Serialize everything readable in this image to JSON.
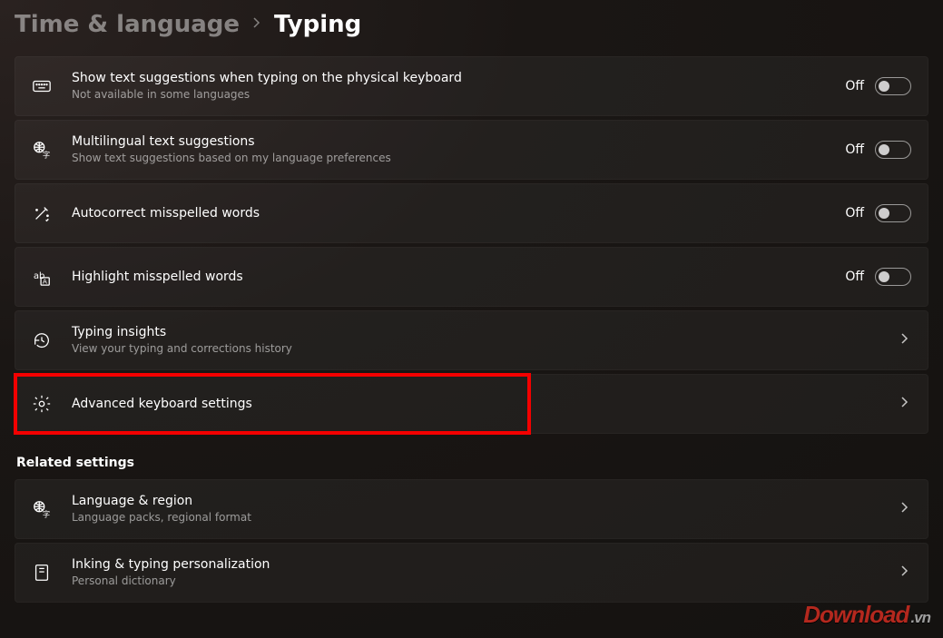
{
  "breadcrumb": {
    "parent": "Time & language",
    "current": "Typing"
  },
  "toggles": {
    "off_label": "Off"
  },
  "items": [
    {
      "icon": "keyboard-icon",
      "title": "Show text suggestions when typing on the physical keyboard",
      "subtitle": "Not available in some languages",
      "trailing": "toggle",
      "highlighted": false
    },
    {
      "icon": "globe-translate-icon",
      "title": "Multilingual text suggestions",
      "subtitle": "Show text suggestions based on my language preferences",
      "trailing": "toggle",
      "highlighted": false
    },
    {
      "icon": "wand-icon",
      "title": "Autocorrect misspelled words",
      "subtitle": "",
      "trailing": "toggle",
      "highlighted": false
    },
    {
      "icon": "spellcheck-icon",
      "title": "Highlight misspelled words",
      "subtitle": "",
      "trailing": "toggle",
      "highlighted": false
    },
    {
      "icon": "history-icon",
      "title": "Typing insights",
      "subtitle": "View your typing and corrections history",
      "trailing": "chevron",
      "highlighted": false
    },
    {
      "icon": "gear-icon",
      "title": "Advanced keyboard settings",
      "subtitle": "",
      "trailing": "chevron",
      "highlighted": true
    }
  ],
  "related": {
    "header": "Related settings",
    "items": [
      {
        "icon": "globe-translate-icon",
        "title": "Language & region",
        "subtitle": "Language packs, regional format",
        "trailing": "chevron"
      },
      {
        "icon": "dictionary-icon",
        "title": "Inking & typing personalization",
        "subtitle": "Personal dictionary",
        "trailing": "chevron"
      }
    ]
  },
  "watermark": {
    "brand": "Download",
    "tld": ".vn"
  }
}
